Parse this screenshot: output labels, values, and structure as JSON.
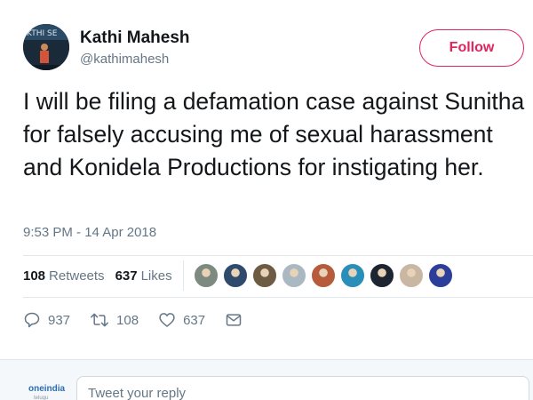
{
  "user": {
    "display_name": "Kathi Mahesh",
    "handle": "@kathimahesh",
    "avatar_text": "KTHI SE"
  },
  "follow_button": {
    "label": "Follow"
  },
  "tweet": {
    "text": "I will be filing a defamation case against Sunitha for falsely accusing me of sexual harassment and Konidela Productions for instigating her.",
    "timestamp": "9:53 PM - 14 Apr 2018"
  },
  "stats": {
    "retweets_count": "108",
    "retweets_label": "Retweets",
    "likes_count": "637",
    "likes_label": "Likes"
  },
  "likers": [
    {
      "color": "#7d8a80"
    },
    {
      "color": "#2f4a6d"
    },
    {
      "color": "#6e5b44"
    },
    {
      "color": "#aab8c2"
    },
    {
      "color": "#b65c3c"
    },
    {
      "color": "#2a8fb8"
    },
    {
      "color": "#1c2530"
    },
    {
      "color": "#c9b7a4"
    },
    {
      "color": "#2c3e9a"
    }
  ],
  "actions": {
    "reply_count": "937",
    "retweet_count": "108",
    "like_count": "637"
  },
  "reply": {
    "placeholder": "Tweet your reply",
    "watermark": "oneindia",
    "watermark_sub": "telugu"
  },
  "colors": {
    "accent": "#e0245e",
    "text_primary": "#14171a",
    "text_secondary": "#657786",
    "divider": "#e1e8ed"
  }
}
